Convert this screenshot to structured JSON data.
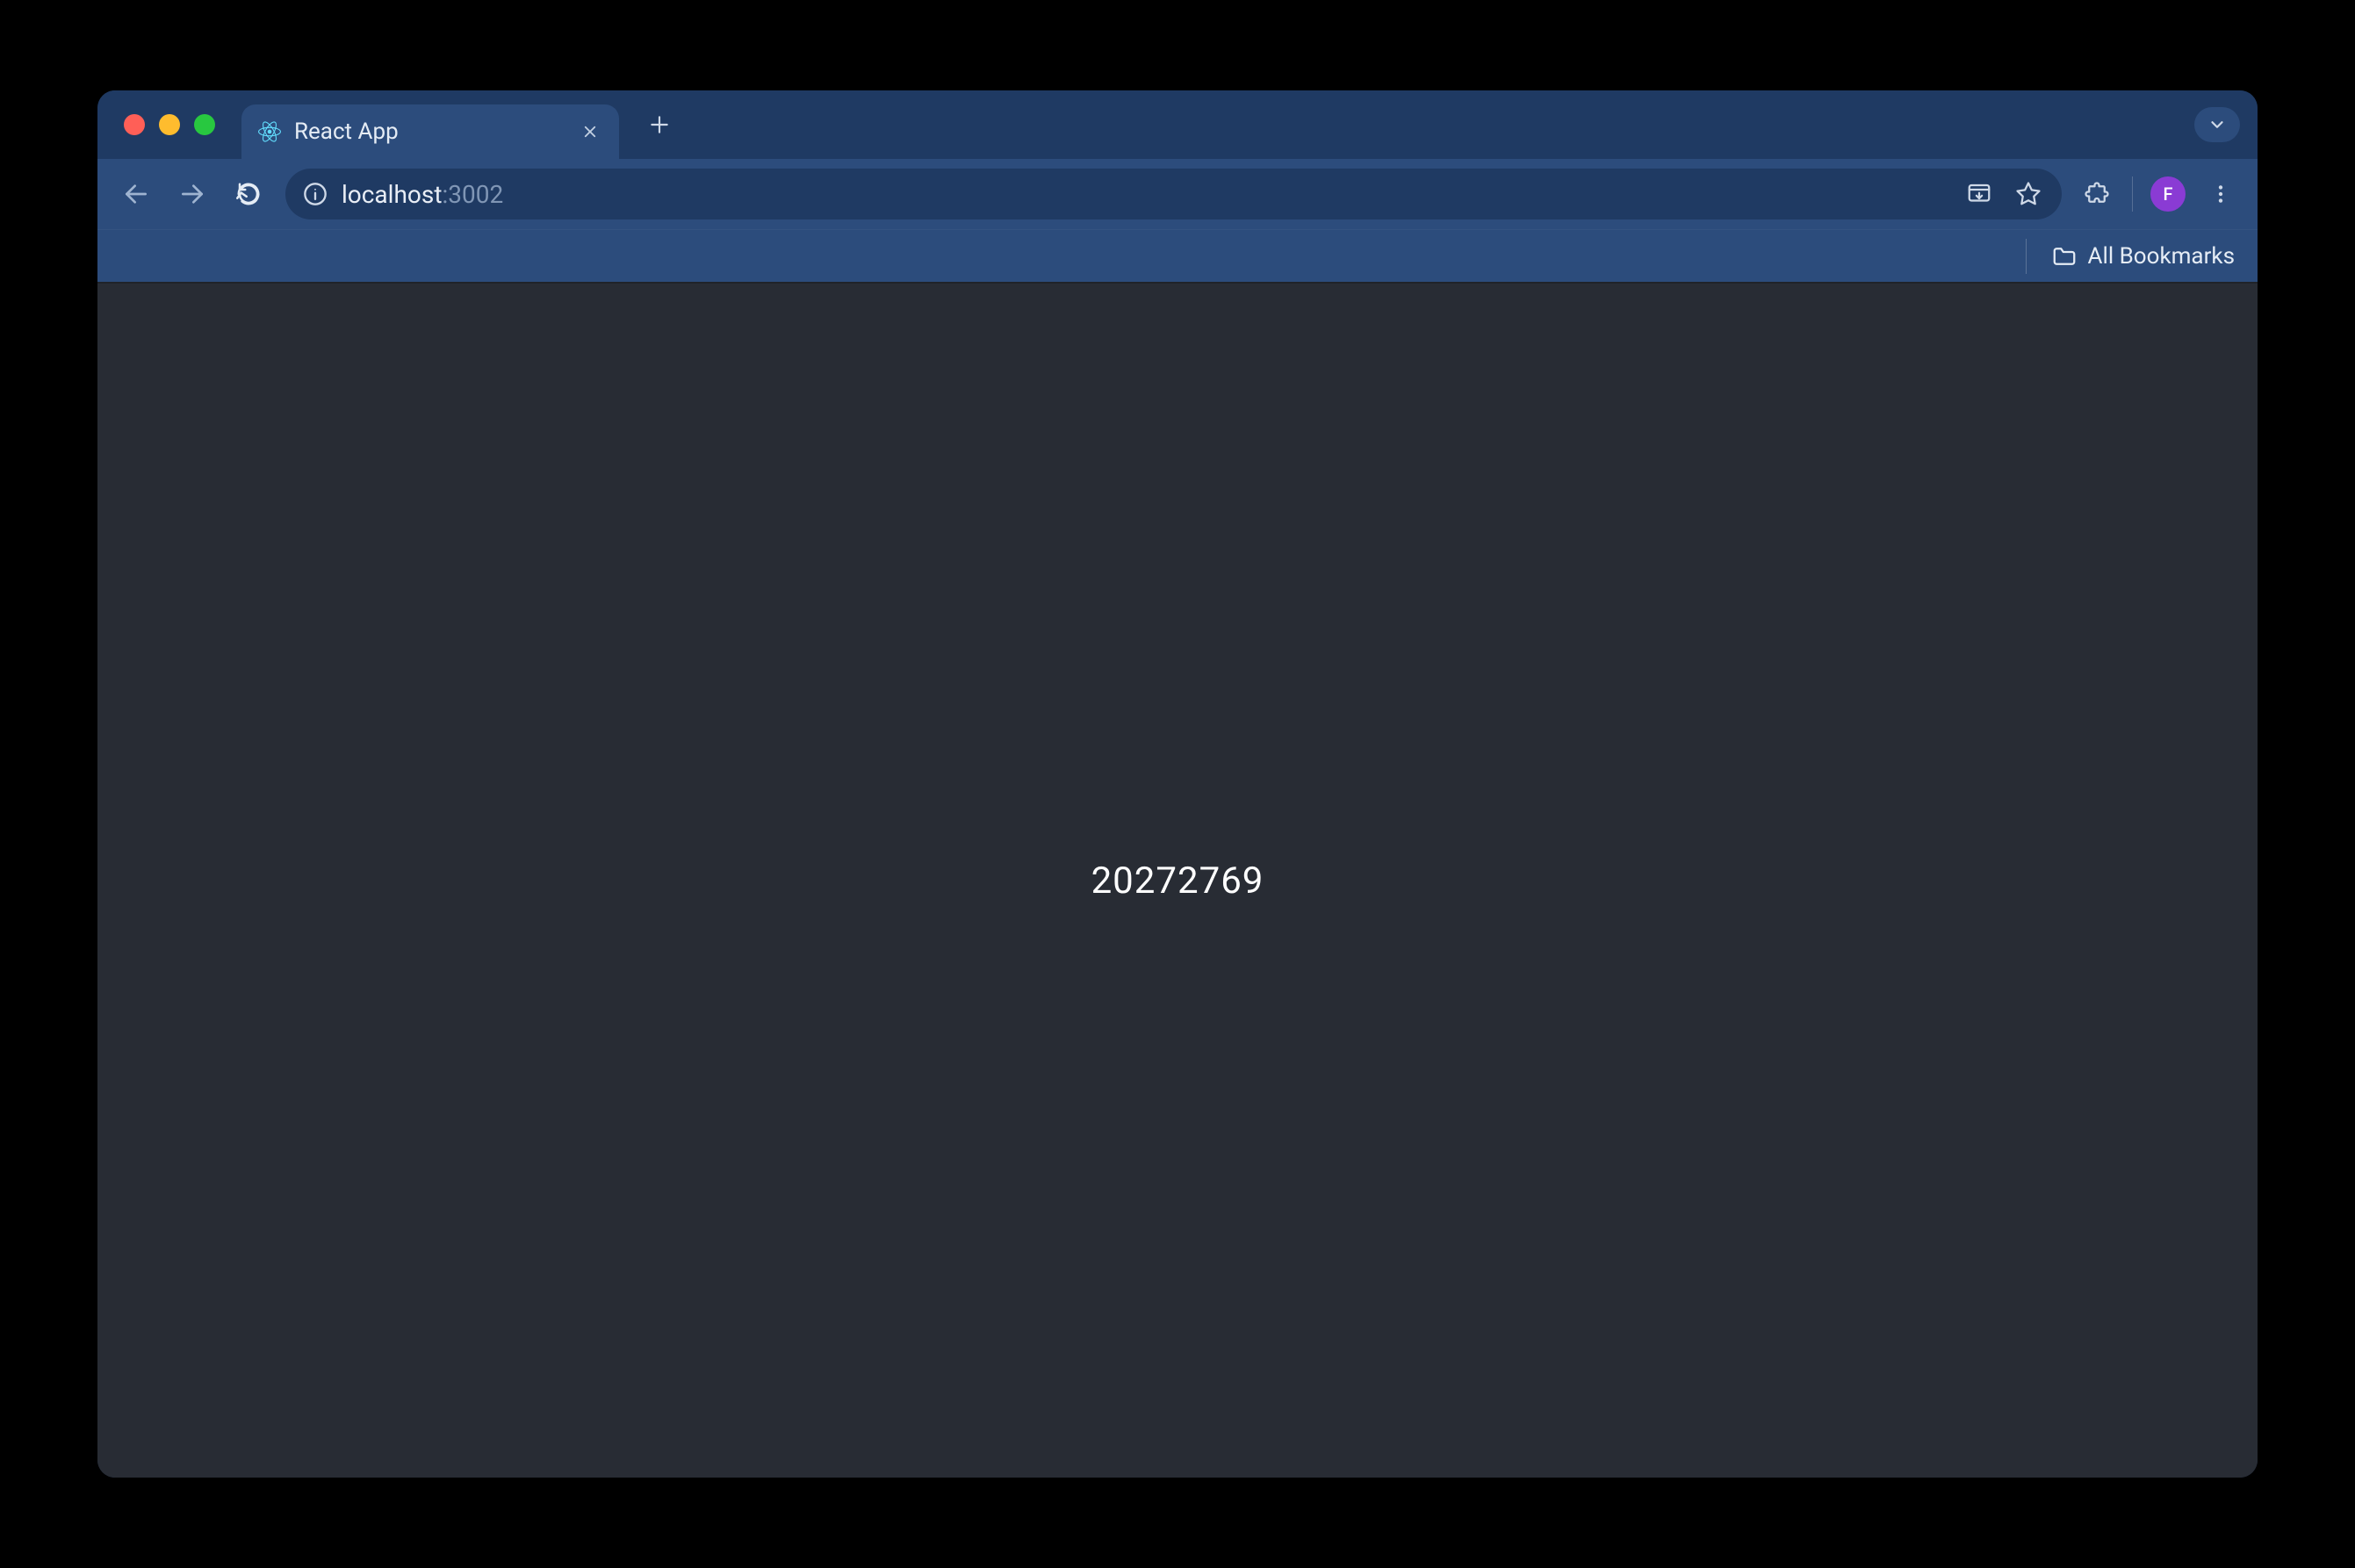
{
  "browser": {
    "tab": {
      "title": "React App",
      "favicon": "react-icon"
    },
    "navigation": {
      "back_enabled": false,
      "forward_enabled": false,
      "reload_enabled": true
    },
    "address": {
      "host": "localhost",
      "port": ":3002",
      "site_info_icon": "info-icon"
    },
    "toolbar_icons": {
      "install": "install-app-icon",
      "bookmark": "star-icon",
      "extensions": "puzzle-icon",
      "menu": "kebab-icon"
    },
    "profile": {
      "initial": "F",
      "color": "#8a3bd4"
    },
    "bookmarks": {
      "all_label": "All Bookmarks",
      "folder_icon": "folder-icon"
    },
    "search_tabs_icon": "chevron-down-icon"
  },
  "page": {
    "content_value": "20272769"
  }
}
